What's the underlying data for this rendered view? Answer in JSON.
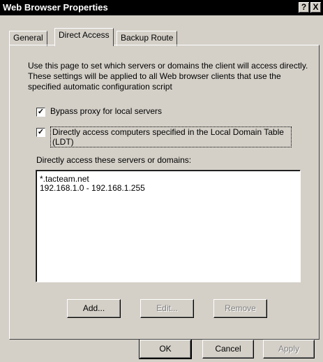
{
  "window": {
    "title": "Web Browser Properties",
    "help_glyph": "?",
    "close_glyph": "X"
  },
  "tabs": [
    {
      "label": "General"
    },
    {
      "label": "Direct Access"
    },
    {
      "label": "Backup Route"
    }
  ],
  "content": {
    "description": "Use this page to set which servers or domains the client will access directly. These settings will be applied to all Web browser clients that use the specified automatic configuration script",
    "bypass_label": "Bypass proxy for local servers",
    "bypass_checked": true,
    "ldt_label": "Directly access computers specified in the Local Domain Table (LDT)",
    "ldt_checked": true,
    "check_glyph": "✓",
    "list_label": "Directly access these servers or domains:",
    "list_items": [
      "*.tacteam.net",
      "192.168.1.0 - 192.168.1.255"
    ]
  },
  "list_buttons": {
    "add": "Add...",
    "edit": "Edit...",
    "remove": "Remove"
  },
  "dialog_buttons": {
    "ok": "OK",
    "cancel": "Cancel",
    "apply": "Apply"
  }
}
